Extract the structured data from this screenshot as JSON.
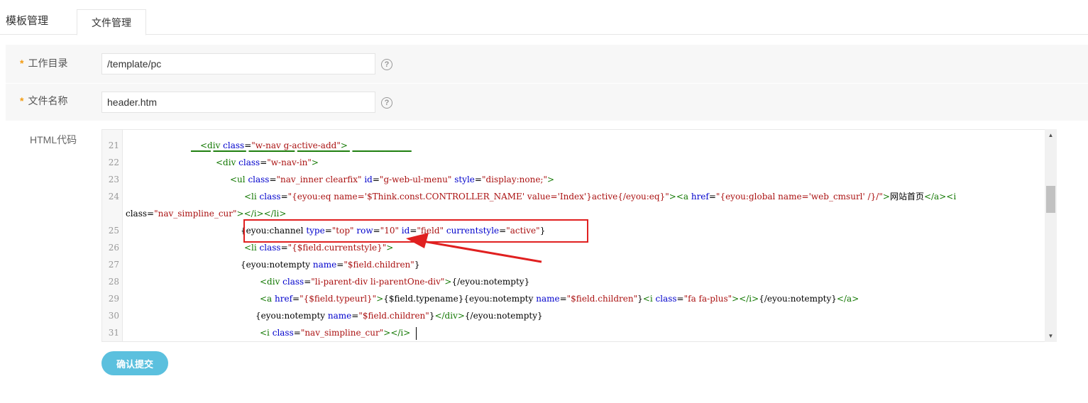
{
  "tabs": {
    "templates": "模板管理",
    "files": "文件管理"
  },
  "form": {
    "work_dir": {
      "label": "工作目录",
      "value": "/template/pc"
    },
    "file_name": {
      "label": "文件名称",
      "value": "header.htm"
    },
    "required_mark": "*",
    "help_icon_text": "?",
    "code_label": "HTML代码"
  },
  "editor": {
    "lines": [
      {
        "num": "21",
        "text": "<div class=\"w-nav g-active-add\">"
      },
      {
        "num": "22",
        "text": "<div class=\"w-nav-in\">"
      },
      {
        "num": "23",
        "text": "<ul class=\"nav_inner clearfix\" id=\"g-web-ul-menu\" style=\"display:none;\">"
      },
      {
        "num": "24",
        "text": "<li class=\"{eyou:eq name='$Think.const.CONTROLLER_NAME' value='Index'}active{/eyou:eq}\"><a href=\"{eyou:global name='web_cmsurl' /}/\">网站首页</a><i"
      },
      {
        "num": "",
        "text": "class=\"nav_simpline_cur\"></i></li>"
      },
      {
        "num": "25",
        "text": "{eyou:channel type=\"top\" row=\"10\" id=\"field\" currentstyle=\"active\"}"
      },
      {
        "num": "26",
        "text": "<li class=\"{$field.currentstyle}\">"
      },
      {
        "num": "27",
        "text": "{eyou:notempty name=\"$field.children\"}"
      },
      {
        "num": "28",
        "text": "<div class=\"li-parent-div li-parentOne-div\">{/eyou:notempty}"
      },
      {
        "num": "29",
        "text": "<a href=\"{$field.typeurl}\">{$field.typename}{eyou:notempty name=\"$field.children\"}<i class=\"fa fa-plus\"></i>{/eyou:notempty}</a>"
      },
      {
        "num": "30",
        "text": "{eyou:notempty name=\"$field.children\"}</div>{/eyou:notempty}"
      },
      {
        "num": "31",
        "text": "<i class=\"nav_simpline_cur\"></i>"
      }
    ]
  },
  "submit_label": "确认提交",
  "colors": {
    "accent": "#5bc0de",
    "required": "#f39c12",
    "annotation": "#e02020"
  }
}
